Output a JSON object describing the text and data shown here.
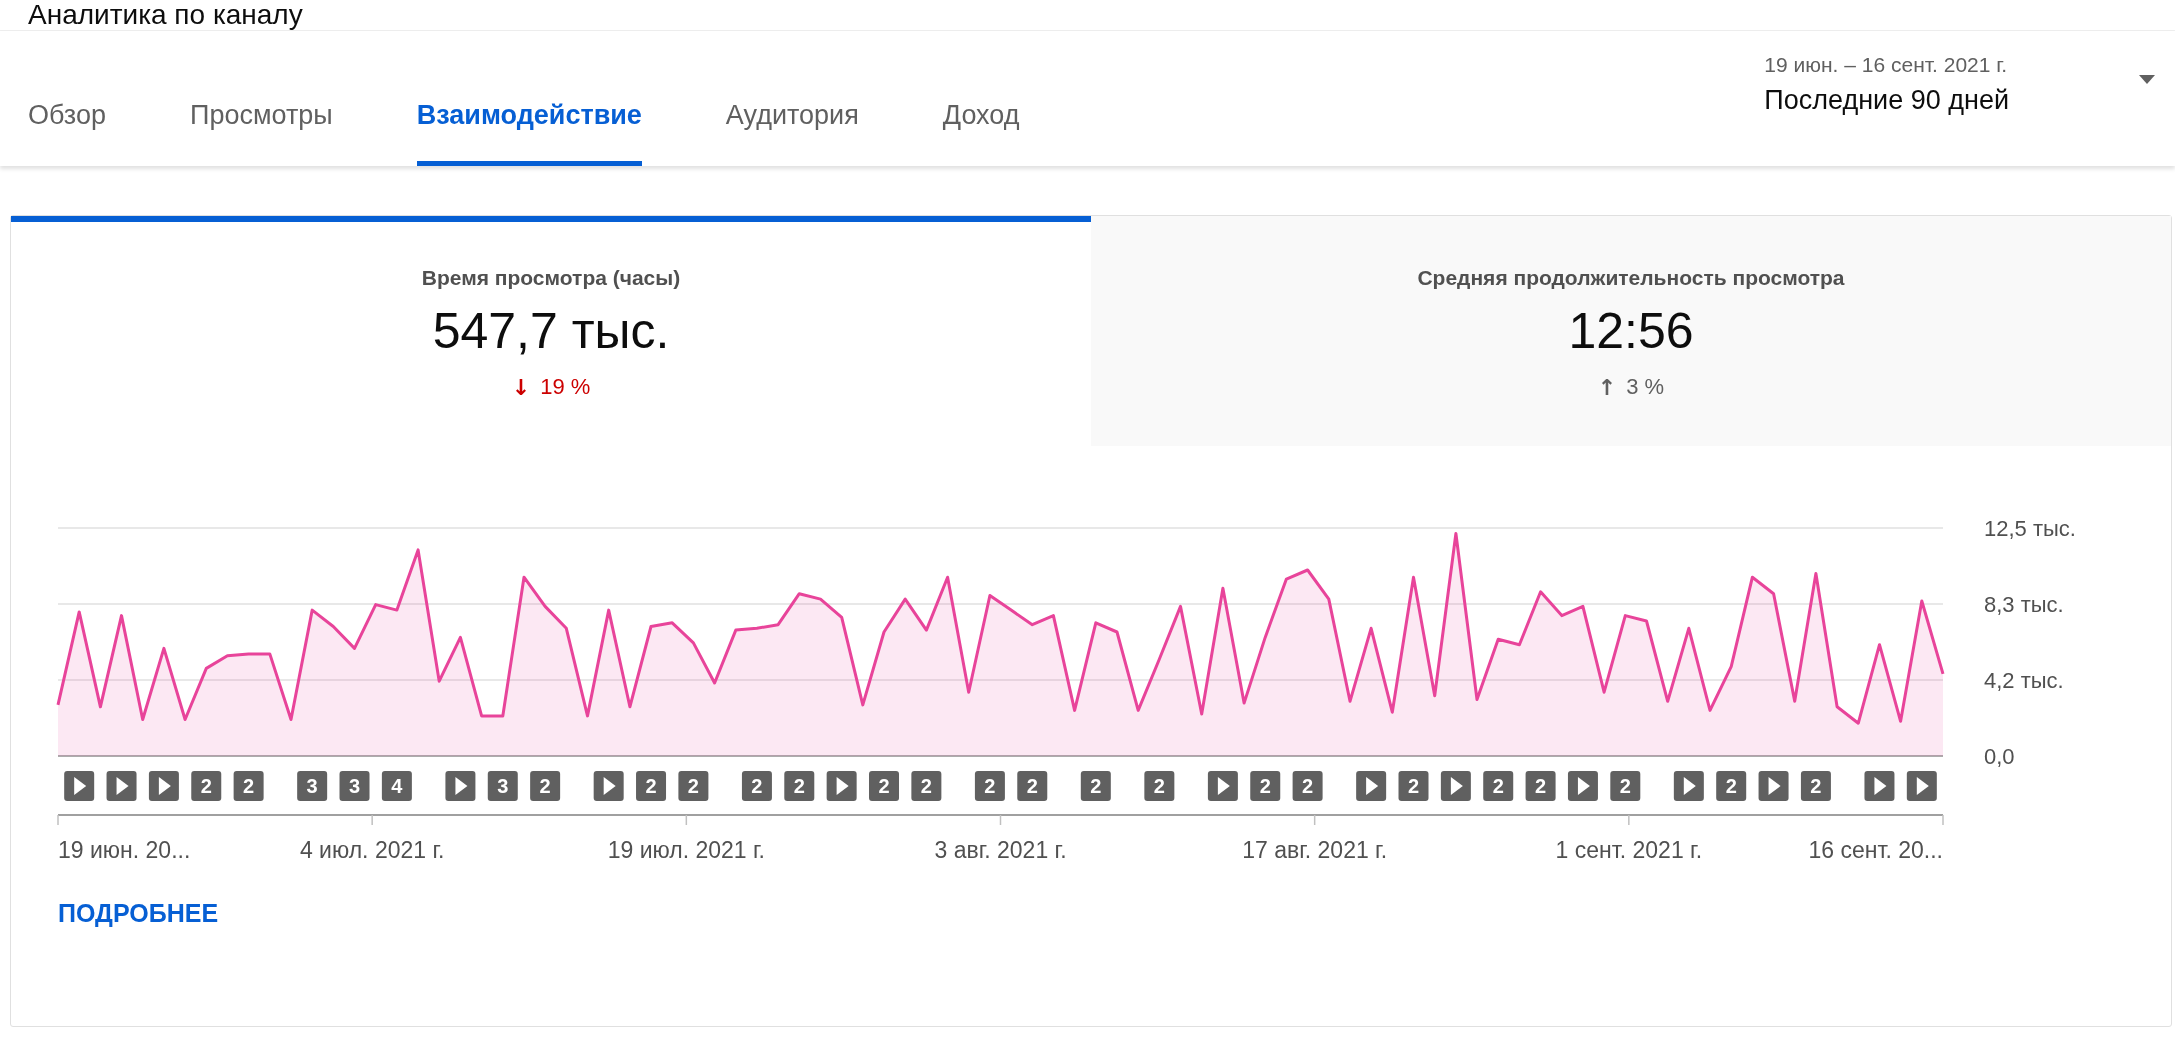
{
  "page_title": "Аналитика по каналу",
  "tabs": [
    {
      "label": "Обзор",
      "selected": false
    },
    {
      "label": "Просмотры",
      "selected": false
    },
    {
      "label": "Взаимодействие",
      "selected": true
    },
    {
      "label": "Аудитория",
      "selected": false
    },
    {
      "label": "Доход",
      "selected": false
    }
  ],
  "date_range": {
    "dates": "19 июн. – 16 сент. 2021 г.",
    "period": "Последние 90 дней"
  },
  "metrics": [
    {
      "label": "Время просмотра (часы)",
      "value": "547,7 тыс.",
      "arrow": "↓",
      "change": "19 %",
      "color": "#cc0000",
      "selected": true
    },
    {
      "label": "Средняя продолжительность просмотра",
      "value": "12:56",
      "arrow": "↑",
      "change": "3 %",
      "color": "#606060",
      "selected": false
    }
  ],
  "chart_data": {
    "type": "area",
    "ylim": [
      0,
      12.5
    ],
    "yticks": [
      {
        "value": 0,
        "label": "0,0"
      },
      {
        "value": 4.1667,
        "label": "4,2 тыс."
      },
      {
        "value": 8.3333,
        "label": "8,3 тыс."
      },
      {
        "value": 12.5,
        "label": "12,5 тыс."
      }
    ],
    "series": [
      {
        "color": "#e8449a",
        "values": [
          2.8,
          7.9,
          2.7,
          7.7,
          2.0,
          5.9,
          2.0,
          4.8,
          5.5,
          5.6,
          5.6,
          2.0,
          8.0,
          7.1,
          5.9,
          8.3,
          8.0,
          11.3,
          4.1,
          6.5,
          2.2,
          2.2,
          9.8,
          8.2,
          7.0,
          2.2,
          8.0,
          2.7,
          7.1,
          7.3,
          6.2,
          4.0,
          6.9,
          7.0,
          7.2,
          8.9,
          8.6,
          7.6,
          2.8,
          6.8,
          8.6,
          6.9,
          9.8,
          3.5,
          8.8,
          8.0,
          7.2,
          7.7,
          2.5,
          7.3,
          6.8,
          2.5,
          5.3,
          8.2,
          2.3,
          9.2,
          2.9,
          6.5,
          9.7,
          10.2,
          8.6,
          3.0,
          7.0,
          2.4,
          9.8,
          3.3,
          12.2,
          3.1,
          6.4,
          6.1,
          9.0,
          7.7,
          8.2,
          3.5,
          7.7,
          7.4,
          3.0,
          7.0,
          2.5,
          4.9,
          9.8,
          8.9,
          3.0,
          10.0,
          2.7,
          1.8,
          6.1,
          1.9,
          8.5,
          4.5
        ]
      }
    ]
  },
  "video_marker_groups": [
    [
      {
        "kind": "play"
      },
      {
        "kind": "play"
      },
      {
        "kind": "play"
      },
      {
        "kind": "count",
        "label": "2"
      },
      {
        "kind": "count",
        "label": "2"
      }
    ],
    [
      {
        "kind": "count",
        "label": "3"
      },
      {
        "kind": "count",
        "label": "3"
      },
      {
        "kind": "count",
        "label": "4"
      }
    ],
    [
      {
        "kind": "play"
      },
      {
        "kind": "count",
        "label": "3"
      },
      {
        "kind": "count",
        "label": "2"
      }
    ],
    [
      {
        "kind": "play"
      },
      {
        "kind": "count",
        "label": "2"
      },
      {
        "kind": "count",
        "label": "2"
      }
    ],
    [
      {
        "kind": "count",
        "label": "2"
      },
      {
        "kind": "count",
        "label": "2"
      },
      {
        "kind": "play"
      },
      {
        "kind": "count",
        "label": "2"
      },
      {
        "kind": "count",
        "label": "2"
      }
    ],
    [
      {
        "kind": "count",
        "label": "2"
      },
      {
        "kind": "count",
        "label": "2"
      }
    ],
    [
      {
        "kind": "count",
        "label": "2"
      }
    ],
    [
      {
        "kind": "count",
        "label": "2"
      }
    ],
    [
      {
        "kind": "play"
      },
      {
        "kind": "count",
        "label": "2"
      },
      {
        "kind": "count",
        "label": "2"
      }
    ],
    [
      {
        "kind": "play"
      },
      {
        "kind": "count",
        "label": "2"
      },
      {
        "kind": "play"
      },
      {
        "kind": "count",
        "label": "2"
      },
      {
        "kind": "count",
        "label": "2"
      },
      {
        "kind": "play"
      },
      {
        "kind": "count",
        "label": "2"
      }
    ],
    [
      {
        "kind": "play"
      },
      {
        "kind": "count",
        "label": "2"
      },
      {
        "kind": "play"
      },
      {
        "kind": "count",
        "label": "2"
      }
    ],
    [
      {
        "kind": "play"
      },
      {
        "kind": "play"
      }
    ]
  ],
  "x_axis_labels": [
    "19 июн. 20...",
    "4 июл. 2021 г.",
    "19 июл. 2021 г.",
    "3 авг. 2021 г.",
    "17 авг. 2021 г.",
    "1 сент. 2021 г.",
    "16 сент. 20..."
  ],
  "more_link": "ПОДРОБНЕЕ"
}
